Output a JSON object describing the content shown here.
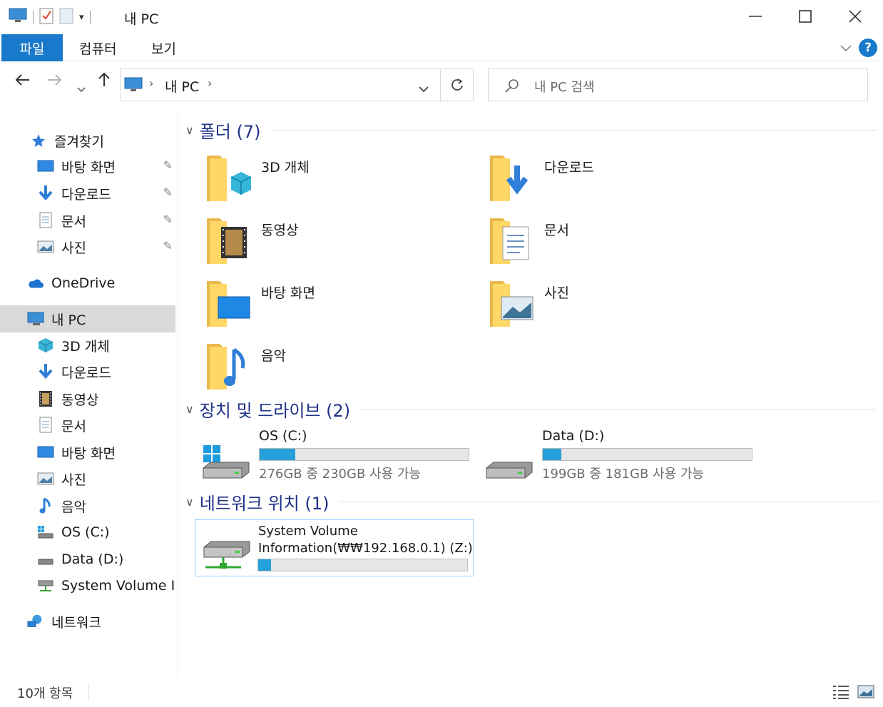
{
  "window": {
    "title": "내 PC"
  },
  "ribbon": {
    "file_tab": "파일",
    "tabs": [
      "컴퓨터",
      "보기"
    ],
    "help": "?"
  },
  "address": {
    "path": [
      "내 PC"
    ]
  },
  "search": {
    "placeholder": "내 PC 검색"
  },
  "sidebar": {
    "quick_access": {
      "label": "즐겨찾기",
      "items": [
        "바탕 화면",
        "다운로드",
        "문서",
        "사진"
      ]
    },
    "onedrive": "OneDrive",
    "this_pc": {
      "label": "내 PC",
      "items": [
        "3D 개체",
        "다운로드",
        "동영상",
        "문서",
        "바탕 화면",
        "사진",
        "음악",
        "OS (C:)",
        "Data (D:)",
        "System Volume Inf"
      ]
    },
    "network": "네트워크"
  },
  "groups": {
    "folders": {
      "title": "폴더 (7)",
      "items": [
        "3D 개체",
        "다운로드",
        "동영상",
        "문서",
        "바탕 화면",
        "사진",
        "음악"
      ]
    },
    "drives": {
      "title": "장치 및 드라이브 (2)",
      "items": [
        {
          "name": "OS (C:)",
          "free_text": "276GB 중 230GB 사용 가능",
          "used_fraction": 0.17
        },
        {
          "name": "Data (D:)",
          "free_text": "199GB 중 181GB 사용 가능",
          "used_fraction": 0.09
        }
      ]
    },
    "network": {
      "title": "네트워크 위치 (1)",
      "items": [
        {
          "name_line1": "System Volume",
          "name_line2": "Information(₩₩192.168.0.1) (Z:)",
          "used_fraction": 0.06
        }
      ]
    }
  },
  "status": {
    "count": "10개 항목"
  },
  "colors": {
    "accent": "#1979ca",
    "group_header": "#1e3287",
    "bar_fill": "#26a0da",
    "selected": "#d9d9d9"
  }
}
